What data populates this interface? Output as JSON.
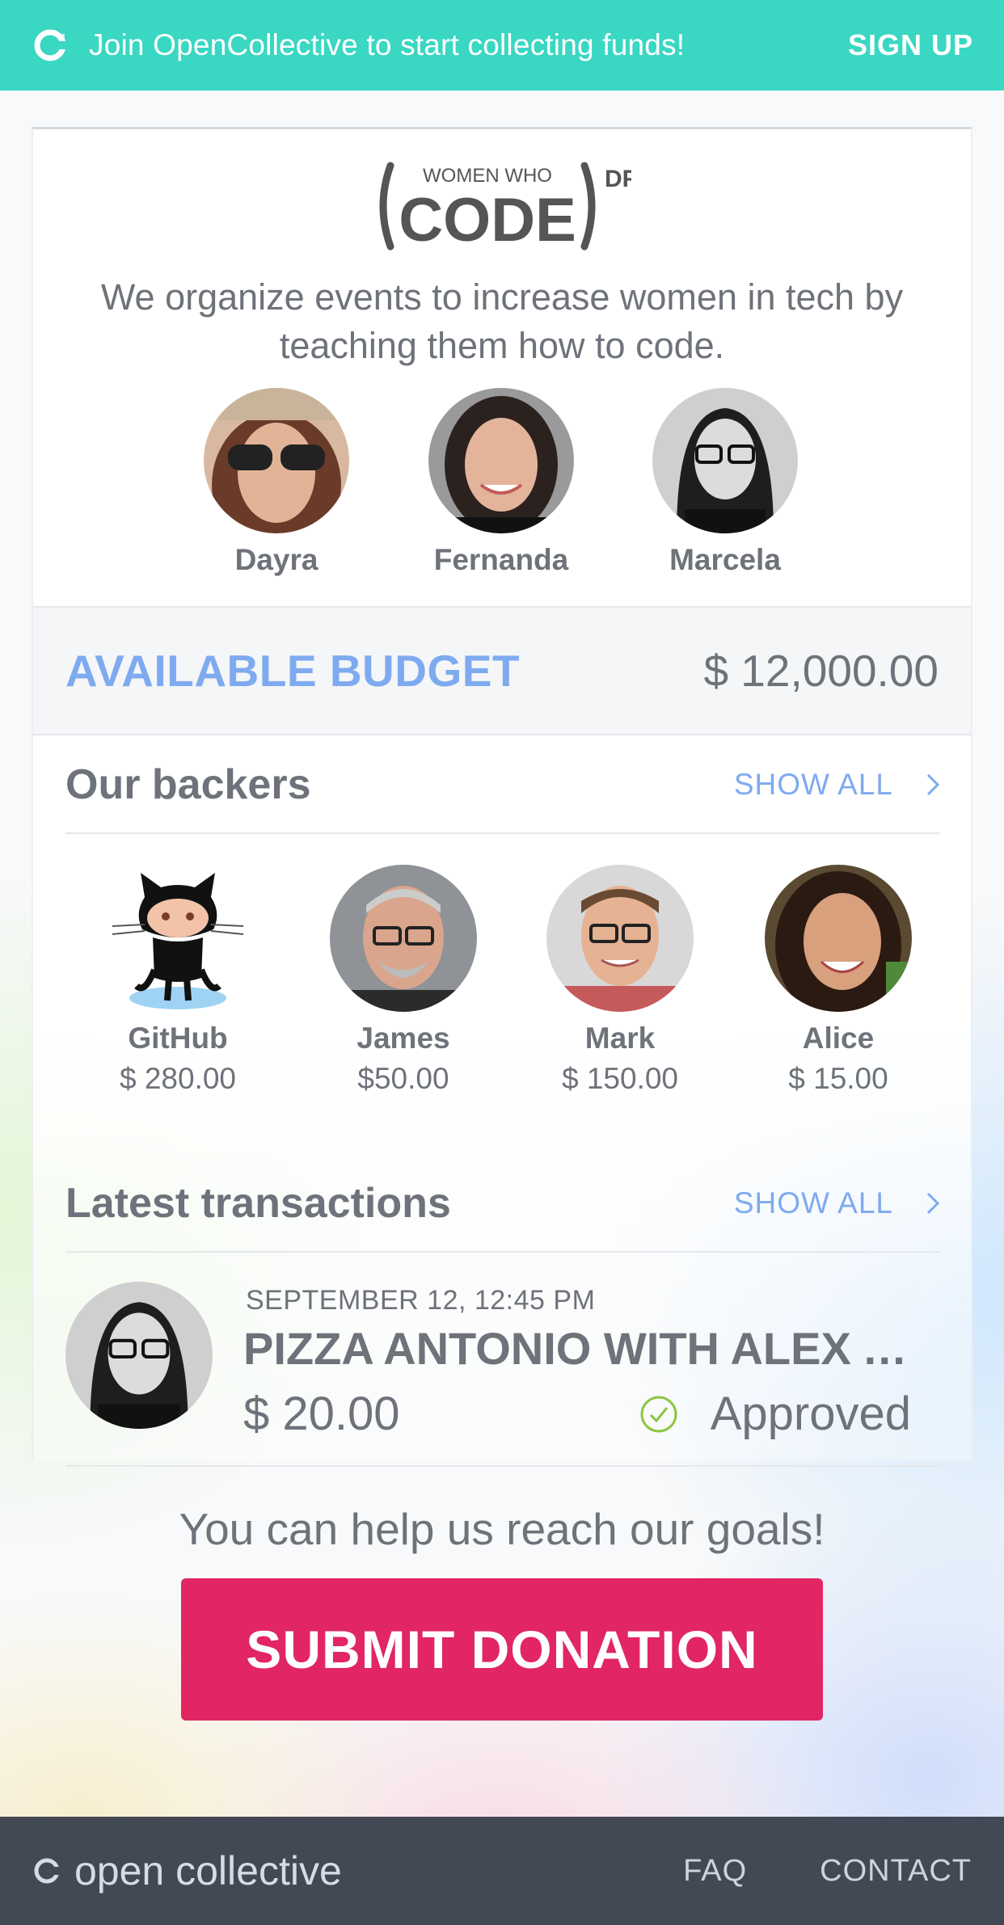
{
  "banner": {
    "text": "Join OpenCollective to start collecting funds!",
    "signup": "SIGN UP"
  },
  "collective": {
    "logo_top": "WOMEN WHO",
    "logo_main": "CODE",
    "logo_suffix": "DF",
    "description": "We organize events to increase women in tech by teaching them how to code.",
    "members": [
      {
        "name": "Dayra"
      },
      {
        "name": "Fernanda"
      },
      {
        "name": "Marcela"
      }
    ]
  },
  "budget": {
    "label": "AVAILABLE BUDGET",
    "value": "$ 12,000.00"
  },
  "backers": {
    "title": "Our backers",
    "show_all": "SHOW ALL",
    "items": [
      {
        "name": "GitHub",
        "amount": "$ 280.00"
      },
      {
        "name": "James",
        "amount": "$50.00"
      },
      {
        "name": "Mark",
        "amount": "$ 150.00"
      },
      {
        "name": "Alice",
        "amount": "$ 15.00"
      }
    ]
  },
  "transactions": {
    "title": "Latest transactions",
    "show_all": "SHOW ALL",
    "items": [
      {
        "date": "SEPTEMBER 12, 12:45 PM",
        "title": "PIZZA ANTONIO WITH ALEX AND FRIENDS",
        "amount": "$ 20.00",
        "status": "Approved"
      }
    ]
  },
  "cta": {
    "text": "You can help us reach our goals!",
    "button": "SUBMIT DONATION"
  },
  "footer": {
    "brand": "open collective",
    "links": [
      "FAQ",
      "CONTACT"
    ]
  },
  "colors": {
    "banner": "#3ad7c3",
    "accent_blue": "#7eaaf0",
    "donate": "#e12663",
    "footer": "#434954",
    "approved": "#8cc63f"
  }
}
